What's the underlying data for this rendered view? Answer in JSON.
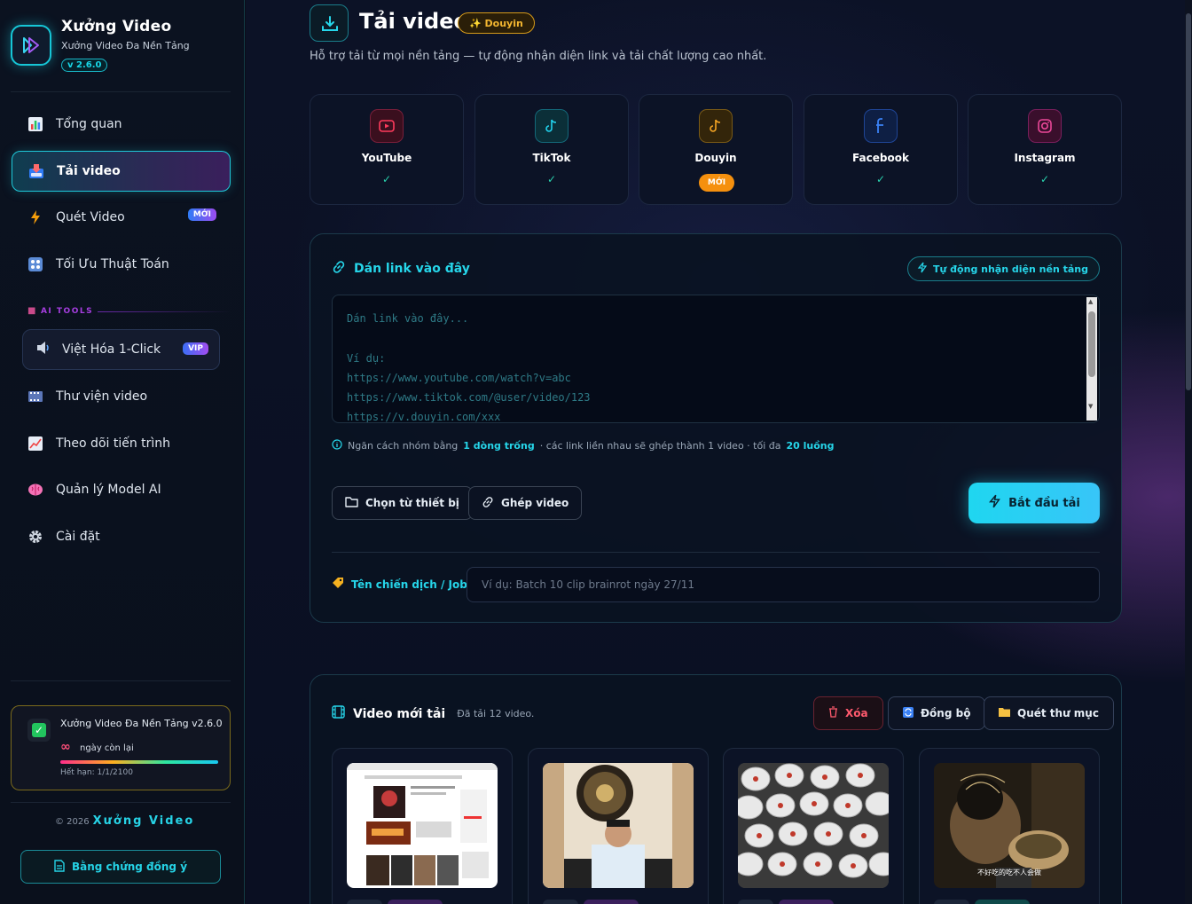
{
  "sidebar": {
    "brand": {
      "title": "Xưởng Video",
      "subtitle": "Xưởng Video Đa Nền Tảng",
      "version": "v 2.6.0"
    },
    "items": [
      {
        "label": "Tổng quan",
        "icon": "bar-chart-icon"
      },
      {
        "label": "Tải video",
        "icon": "download-inbox-icon",
        "active": true
      },
      {
        "label": "Quét Video",
        "icon": "lightning-icon",
        "badge": "MỚI"
      },
      {
        "label": "Tối Ưu Thuật Toán",
        "icon": "grid-icon"
      }
    ],
    "ai_tools_label": "AI TOOLS",
    "vip_item": {
      "label": "Việt Hóa 1-Click",
      "badge": "VIP",
      "icon": "speaker-icon"
    },
    "items2": [
      {
        "label": "Thư viện video",
        "icon": "film-icon"
      },
      {
        "label": "Theo dõi tiến trình",
        "icon": "trend-chart-icon"
      },
      {
        "label": "Quản lý Model AI",
        "icon": "brain-icon"
      },
      {
        "label": "Cài đặt",
        "icon": "gear-icon"
      }
    ],
    "license": {
      "title": "Xưởng Video Đa Nền Tảng v2.6.0",
      "infinity": "∞",
      "days_label": "ngày còn lại",
      "expiry": "Hết hạn: 1/1/2100"
    },
    "copyright_prefix": "© 2026",
    "copyright_brand": "Xưởng Video",
    "proof_button": "Bằng chứng đồng ý"
  },
  "header": {
    "title": "Tải video",
    "pill": "✨ Douyin",
    "subtitle": "Hỗ trợ tải từ mọi nền tảng — tự động nhận diện link và tải chất lượng cao nhất."
  },
  "platforms": [
    {
      "name": "YouTube",
      "check": "✓",
      "color": "#ff3b5c"
    },
    {
      "name": "TikTok",
      "check": "✓",
      "color": "#22d3ee"
    },
    {
      "name": "Douyin",
      "badge": "MỚI",
      "color": "#f5a524"
    },
    {
      "name": "Facebook",
      "check": "✓",
      "color": "#3b82f6"
    },
    {
      "name": "Instagram",
      "check": "✓",
      "color": "#ec4899"
    }
  ],
  "paste": {
    "title": "Dán link vào đây",
    "auto_detect": "Tự động nhận diện nền tảng",
    "placeholder": "Dán link vào đây...\n\nVí dụ:\nhttps://www.youtube.com/watch?v=abc\nhttps://www.tiktok.com/@user/video/123\nhttps://v.douyin.com/xxx",
    "hint_prefix": "Ngăn cách nhóm bằng",
    "hint_bold1": "1 dòng trống",
    "hint_mid": "· các link liền nhau sẽ ghép thành 1 video · tối đa",
    "hint_bold2": "20 luồng",
    "choose_device": "Chọn từ thiết bị",
    "merge_video": "Ghép video",
    "start": "Bắt đầu tải",
    "job_label": "Tên chiến dịch / Job",
    "job_placeholder": "Ví dụ: Batch 10 clip brainrot ngày 27/11"
  },
  "videos": {
    "title": "Video mới tải",
    "count_text": "Đã tải 12 video.",
    "delete": "Xóa",
    "sync": "Đồng bộ",
    "scan_folder": "Quét thư mục",
    "thumb_caption": "不好吃的吃不人会做"
  }
}
